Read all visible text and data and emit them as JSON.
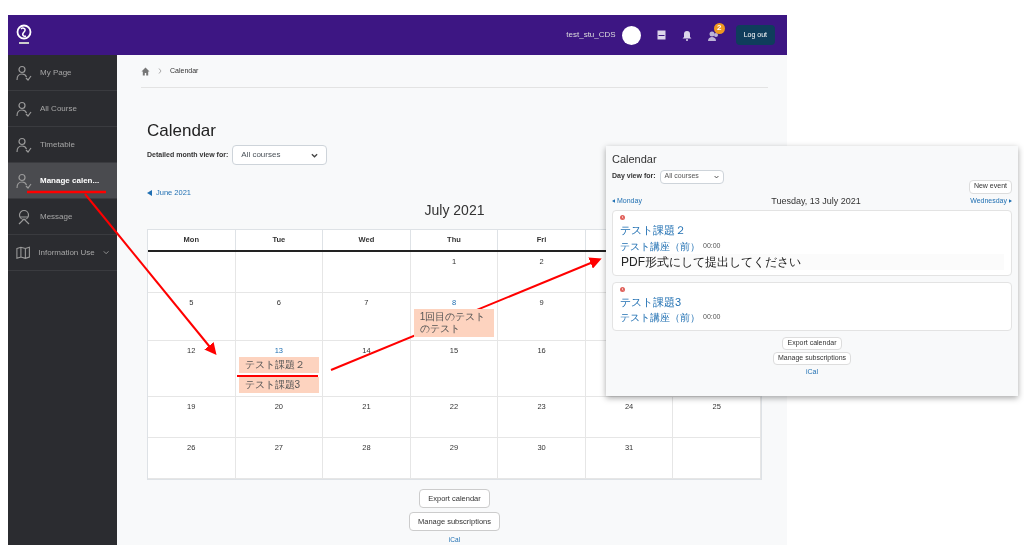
{
  "header": {
    "user": "test_stu_CDS",
    "badge": "2",
    "logout": "Log out"
  },
  "sidebar": {
    "items": [
      {
        "label": "My Page",
        "kind": "person",
        "selected": false
      },
      {
        "label": "All Course",
        "kind": "person",
        "selected": false
      },
      {
        "label": "Timetable",
        "kind": "person",
        "selected": false
      },
      {
        "label": "Manage calen...",
        "kind": "person",
        "selected": true
      },
      {
        "label": "Message",
        "kind": "message",
        "selected": false
      },
      {
        "label": "Information Use",
        "kind": "map",
        "selected": false,
        "expandable": true
      }
    ]
  },
  "breadcrumb": [
    "Calendar"
  ],
  "page": {
    "title": "Calendar",
    "filter_label": "Detailed month view for:",
    "filter_value": "All courses",
    "prev_month": "June 2021",
    "month": "July 2021",
    "weekdays": [
      "Mon",
      "Tue",
      "Wed",
      "Thu",
      "Fri"
    ],
    "weeks": [
      [
        {
          "kind": "blank"
        },
        {
          "kind": "blank"
        },
        {
          "kind": "blank"
        },
        {
          "kind": "day",
          "day": "1"
        },
        {
          "kind": "day",
          "day": "2"
        },
        {
          "kind": "blank"
        },
        {
          "kind": "blank"
        }
      ],
      [
        {
          "kind": "day",
          "day": "5"
        },
        {
          "kind": "day",
          "day": "6"
        },
        {
          "kind": "day",
          "day": "7"
        },
        {
          "kind": "day",
          "day": "8",
          "events": [
            "1回目のテストのテスト"
          ]
        },
        {
          "kind": "day",
          "day": "9"
        },
        {
          "kind": "blank"
        },
        {
          "kind": "blank"
        }
      ],
      [
        {
          "kind": "day",
          "day": "12"
        },
        {
          "kind": "day",
          "day": "13",
          "events": [
            "テスト課題２",
            "テスト課題3"
          ]
        },
        {
          "kind": "day",
          "day": "14"
        },
        {
          "kind": "day",
          "day": "15"
        },
        {
          "kind": "day",
          "day": "16"
        },
        {
          "kind": "blank"
        },
        {
          "kind": "blank"
        }
      ],
      [
        {
          "kind": "day",
          "day": "19"
        },
        {
          "kind": "day",
          "day": "20"
        },
        {
          "kind": "day",
          "day": "21"
        },
        {
          "kind": "day",
          "day": "22"
        },
        {
          "kind": "day",
          "day": "23"
        },
        {
          "kind": "day",
          "day": "24"
        },
        {
          "kind": "day",
          "day": "25"
        }
      ],
      [
        {
          "kind": "day",
          "day": "26"
        },
        {
          "kind": "day",
          "day": "27"
        },
        {
          "kind": "day",
          "day": "28"
        },
        {
          "kind": "day",
          "day": "29"
        },
        {
          "kind": "day",
          "day": "30"
        },
        {
          "kind": "day",
          "day": "31"
        },
        {
          "kind": "blank"
        }
      ]
    ],
    "buttons": [
      "Export calendar",
      "Manage subscriptions"
    ],
    "link": "iCal"
  },
  "inset": {
    "title": "Calendar",
    "filter_label": "Day view for:",
    "filter_value": "All courses",
    "new_event": "New event",
    "prev": "Monday",
    "next": "Wednesday",
    "date": "Tuesday, 13 July 2021",
    "events": [
      {
        "title": "テスト課題２",
        "course": "テスト講座（前）",
        "time": "00:00",
        "description": "PDF形式にして提出してください"
      },
      {
        "title": "テスト課題3",
        "course": "テスト講座（前）",
        "time": "00:00"
      }
    ],
    "buttons": [
      "Export calendar",
      "Manage subscriptions"
    ],
    "link": "iCal"
  }
}
